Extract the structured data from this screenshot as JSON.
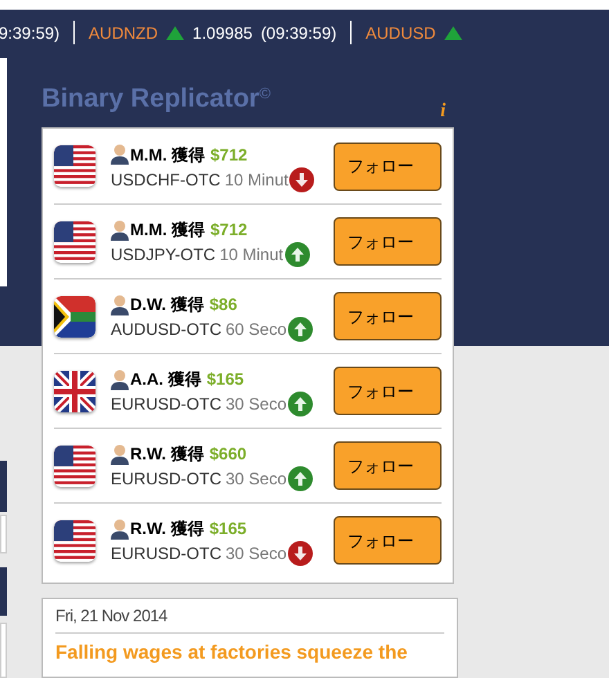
{
  "ticker": [
    {
      "time": "9:39:59)"
    },
    {
      "pair": "AUDNZD",
      "rising": true,
      "price": "1.09985",
      "time": "(09:39:59)"
    },
    {
      "pair": "AUDUSD",
      "rising": true
    }
  ],
  "widget": {
    "title": "Binary Replicator",
    "title_mark": "©",
    "info": "i",
    "trades": [
      {
        "kind": "us",
        "trader": "M.M. 獲得",
        "amount": "$712",
        "asset": "USDCHF-OTC",
        "period": "10 Minut",
        "rising": false,
        "button": "フォロー"
      },
      {
        "kind": "us",
        "trader": "M.M. 獲得",
        "amount": "$712",
        "asset": "USDJPY-OTC",
        "period": "10 Minut",
        "rising": true,
        "button": "フォロー"
      },
      {
        "kind": "za",
        "trader": "D.W. 獲得",
        "amount": "$86",
        "asset": "AUDUSD-OTC",
        "period": "60 Seco",
        "rising": true,
        "button": "フォロー"
      },
      {
        "kind": "gb",
        "trader": "A.A. 獲得",
        "amount": "$165",
        "asset": "EURUSD-OTC",
        "period": "30 Seco",
        "rising": true,
        "button": "フォロー"
      },
      {
        "kind": "us",
        "trader": "R.W. 獲得",
        "amount": "$660",
        "asset": "EURUSD-OTC",
        "period": "30 Seco",
        "rising": true,
        "button": "フォロー"
      },
      {
        "kind": "us",
        "trader": "R.W. 獲得",
        "amount": "$165",
        "asset": "EURUSD-OTC",
        "period": "30 Seco",
        "rising": false,
        "button": "フォロー"
      }
    ]
  },
  "news": {
    "date": "Fri, 21 Nov 2014",
    "headline": "Falling wages at factories squeeze the"
  }
}
